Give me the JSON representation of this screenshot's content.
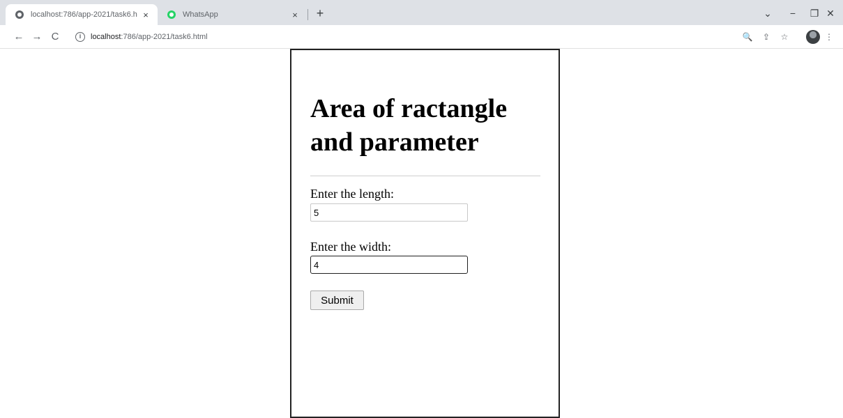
{
  "browser": {
    "tabs": [
      {
        "title": "localhost:786/app-2021/task6.h",
        "active": true,
        "close": "×"
      },
      {
        "title": "WhatsApp",
        "active": false,
        "close": "×"
      }
    ],
    "new_tab": "+",
    "window_controls": {
      "dropdown": "⌄",
      "minimize": "−",
      "restore": "❐",
      "close": "✕"
    },
    "nav": {
      "back": "←",
      "forward": "→",
      "reload": "C"
    },
    "address": {
      "host": "localhost",
      "path": ":786/app-2021/task6.html"
    },
    "toolbar_icons": {
      "zoom": "🔍",
      "share": "⇪",
      "bookmark": "☆",
      "menu": "⋮"
    }
  },
  "page": {
    "heading": "Area of ractangle and parameter",
    "length_label": "Enter the length:",
    "length_value": "5",
    "width_label": "Enter the width:",
    "width_value": "4",
    "submit_label": "Submit"
  }
}
